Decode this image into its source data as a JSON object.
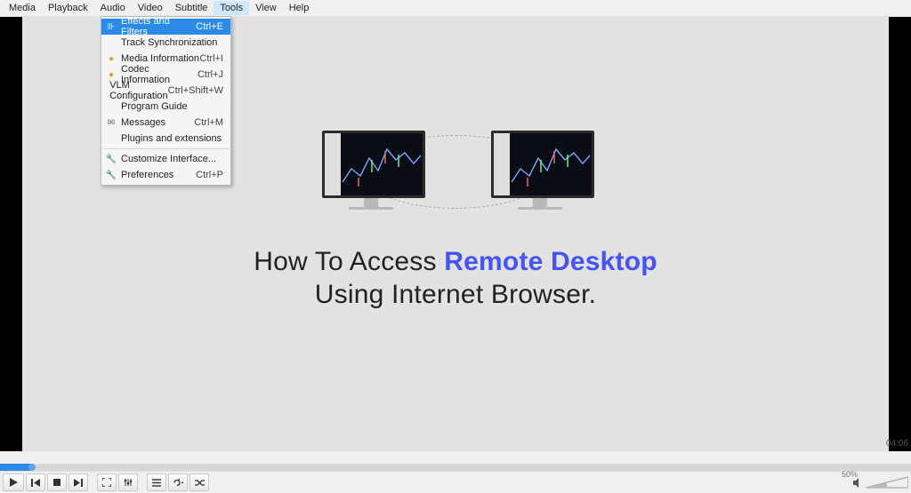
{
  "menubar": {
    "items": [
      "Media",
      "Playback",
      "Audio",
      "Video",
      "Subtitle",
      "Tools",
      "View",
      "Help"
    ],
    "active_index": 5
  },
  "tools_menu": {
    "groups": [
      [
        {
          "icon": "sliders",
          "label": "Effects and Filters",
          "shortcut": "Ctrl+E",
          "highlight": true
        },
        {
          "icon": "",
          "label": "Track Synchronization",
          "shortcut": ""
        },
        {
          "icon": "info-warn",
          "label": "Media Information",
          "shortcut": "Ctrl+I"
        },
        {
          "icon": "info-warn",
          "label": "Codec Information",
          "shortcut": "Ctrl+J"
        },
        {
          "icon": "",
          "label": "VLM Configuration",
          "shortcut": "Ctrl+Shift+W"
        },
        {
          "icon": "",
          "label": "Program Guide",
          "shortcut": ""
        },
        {
          "icon": "message",
          "label": "Messages",
          "shortcut": "Ctrl+M"
        },
        {
          "icon": "",
          "label": "Plugins and extensions",
          "shortcut": ""
        }
      ],
      [
        {
          "icon": "wrench",
          "label": "Customize Interface...",
          "shortcut": ""
        },
        {
          "icon": "wrench",
          "label": "Preferences",
          "shortcut": "Ctrl+P"
        }
      ]
    ]
  },
  "video_content": {
    "title_plain1": "How To Access ",
    "title_bold": "Remote Desktop",
    "title_line2": "Using Internet Browser."
  },
  "playback": {
    "elapsed": "",
    "total": "04:06",
    "played_pct": 3.5,
    "volume_pct": "50%"
  },
  "control_icons": {
    "play": "play",
    "prev": "prev",
    "stop": "stop",
    "next": "next",
    "fullscreen": "fullscreen",
    "extended": "extended",
    "playlist": "playlist",
    "loop": "loop",
    "shuffle": "shuffle",
    "speaker": "speaker"
  }
}
